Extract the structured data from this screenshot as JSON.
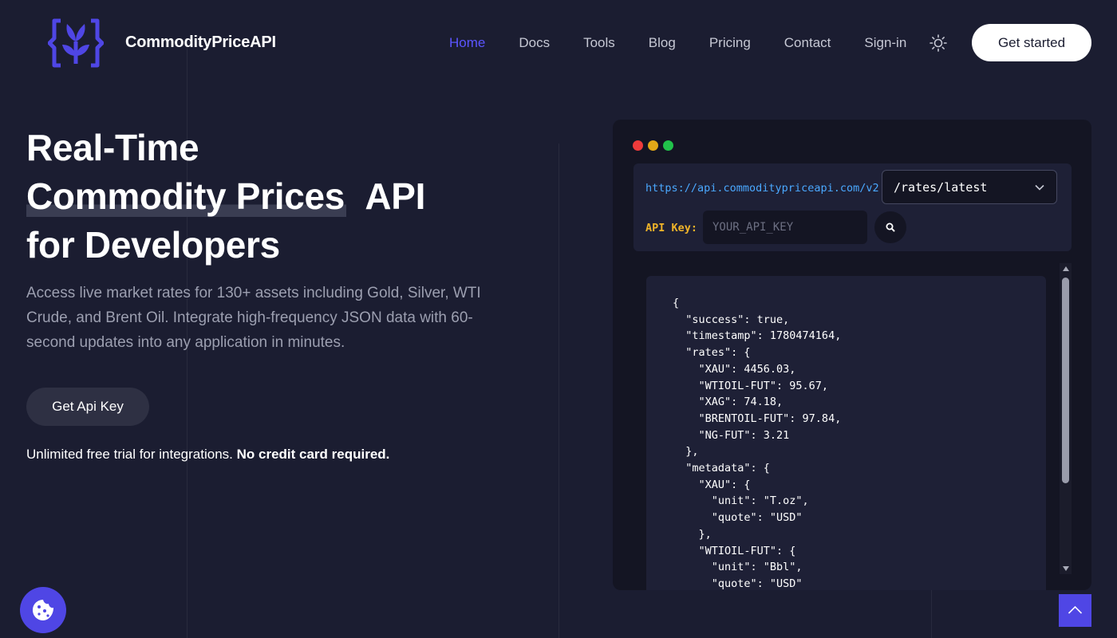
{
  "brand": {
    "name": "CommodityPriceAPI",
    "logo_icon": "sprout-braces-icon",
    "logo_color": "#4f46e5"
  },
  "nav": {
    "items": [
      "Home",
      "Docs",
      "Tools",
      "Blog",
      "Pricing",
      "Contact",
      "Sign-in"
    ],
    "active": "Home",
    "theme_icon": "sun-icon",
    "cta": "Get started"
  },
  "hero": {
    "title_line1": "Real-Time",
    "title_highlight": "Commodity Prices",
    "title_line2_rest": "API",
    "title_line3": "for Developers",
    "description": "Access live market rates for 130+ assets including Gold, Silver, WTI Crude, and Brent Oil. Integrate high-frequency JSON data with 60-second updates into any application in minutes.",
    "button": "Get Api Key",
    "note_prefix": "Unlimited free trial for integrations.",
    "note_bold": "No credit card required."
  },
  "api_demo": {
    "base_url": "https://api.commoditypriceapi.com/v2",
    "endpoint": "/rates/latest",
    "api_key_label": "API Key:",
    "api_key_placeholder": "YOUR_API_KEY",
    "response": "{\n  \"success\": true,\n  \"timestamp\": 1780474164,\n  \"rates\": {\n    \"XAU\": 4456.03,\n    \"WTIOIL-FUT\": 95.67,\n    \"XAG\": 74.18,\n    \"BRENTOIL-FUT\": 97.84,\n    \"NG-FUT\": 3.21\n  },\n  \"metadata\": {\n    \"XAU\": {\n      \"unit\": \"T.oz\",\n      \"quote\": \"USD\"\n    },\n    \"WTIOIL-FUT\": {\n      \"unit\": \"Bbl\",\n      \"quote\": \"USD\"\n    }\n  }\n}"
  },
  "colors": {
    "background": "#1b1d31",
    "accent": "#5b55ff",
    "url": "#4aa8ff",
    "label": "#f0b429"
  }
}
